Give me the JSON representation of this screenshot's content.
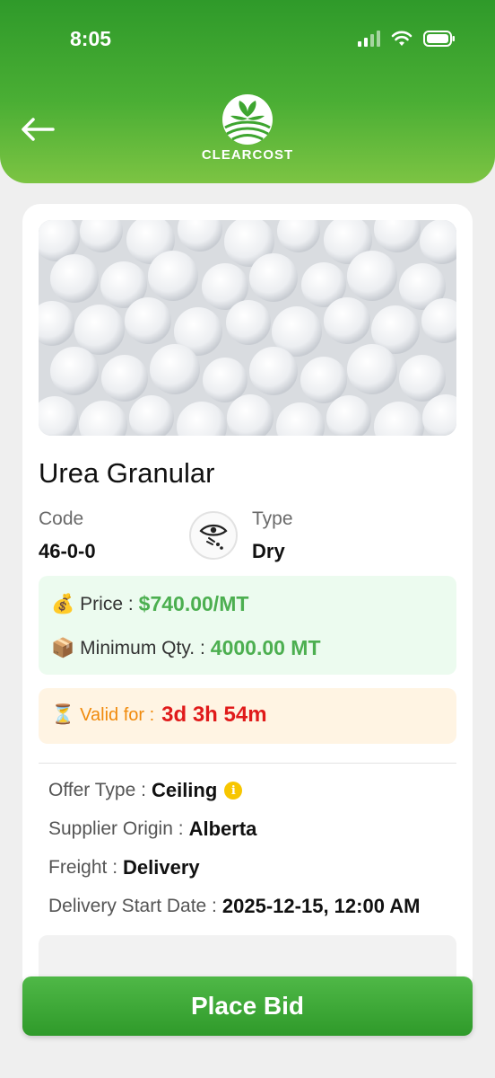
{
  "status_bar": {
    "time": "8:05"
  },
  "header": {
    "brand": "CLEARCOST"
  },
  "product": {
    "name": "Urea Granular",
    "code_label": "Code",
    "code": "46-0-0",
    "type_label": "Type",
    "type": "Dry"
  },
  "pricing": {
    "price_icon": "💰",
    "price_label": "Price :",
    "price": "$740.00/MT",
    "min_qty_icon": "📦",
    "min_qty_label": "Minimum Qty. :",
    "min_qty": "4000.00 MT"
  },
  "validity": {
    "icon": "⏳",
    "label": "Valid for :",
    "value": "3d 3h 54m"
  },
  "details": {
    "offer_type_label": "Offer Type :",
    "offer_type": "Ceiling",
    "supplier_origin_label": "Supplier Origin :",
    "supplier_origin": "Alberta",
    "freight_label": "Freight :",
    "freight": "Delivery",
    "delivery_start_label": "Delivery Start Date :",
    "delivery_start": "2025-12-15, 12:00 AM"
  },
  "actions": {
    "place_bid": "Place Bid"
  },
  "colors": {
    "primary_green": "#2f9a2a",
    "price_green": "#4caf50",
    "timer_red": "#e01a1a",
    "valid_orange": "#f08a0c"
  }
}
